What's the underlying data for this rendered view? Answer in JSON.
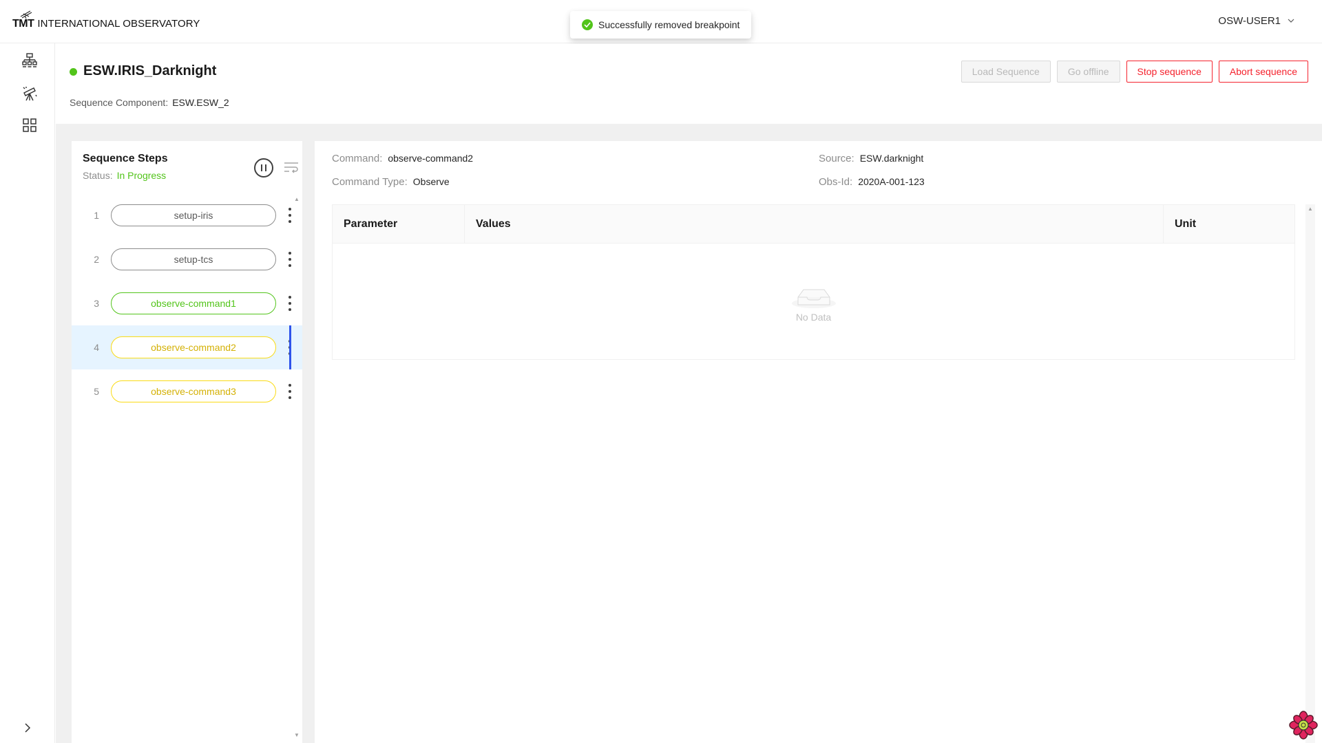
{
  "header": {
    "logo_mark": "TMT",
    "logo_text": "INTERNATIONAL OBSERVATORY",
    "user": "OSW-USER1"
  },
  "toast": {
    "message": "Successfully removed breakpoint"
  },
  "sidenav": {
    "items": [
      {
        "icon": "hierarchy-icon"
      },
      {
        "icon": "telescope-icon"
      },
      {
        "icon": "grid-icon"
      }
    ],
    "collapse_icon": "chevron-right-icon"
  },
  "sequencer": {
    "name": "ESW.IRIS_Darknight",
    "status_color": "#52c41a",
    "component_label": "Sequence Component:",
    "component_value": "ESW.ESW_2"
  },
  "actions": {
    "load": "Load Sequence",
    "offline": "Go offline",
    "stop": "Stop sequence",
    "abort": "Abort sequence"
  },
  "steps": {
    "title": "Sequence Steps",
    "status_label": "Status:",
    "status_value": "In Progress",
    "items": [
      {
        "num": "1",
        "label": "setup-iris",
        "state": "finished"
      },
      {
        "num": "2",
        "label": "setup-tcs",
        "state": "finished"
      },
      {
        "num": "3",
        "label": "observe-command1",
        "state": "success"
      },
      {
        "num": "4",
        "label": "observe-command2",
        "state": "pending",
        "selected": true
      },
      {
        "num": "5",
        "label": "observe-command3",
        "state": "pending"
      }
    ]
  },
  "details": {
    "command_label": "Command:",
    "command_value": "observe-command2",
    "type_label": "Command Type:",
    "type_value": "Observe",
    "source_label": "Source:",
    "source_value": "ESW.darknight",
    "obsid_label": "Obs-Id:",
    "obsid_value": "2020A-001-123",
    "table": {
      "columns": [
        "Parameter",
        "Values",
        "Unit"
      ],
      "empty_text": "No Data"
    }
  },
  "colors": {
    "success": "#52c41a",
    "danger": "#f5222d",
    "pending": "#fadb14",
    "selected_bg": "#e6f4ff",
    "selected_bar": "#2f54eb"
  }
}
